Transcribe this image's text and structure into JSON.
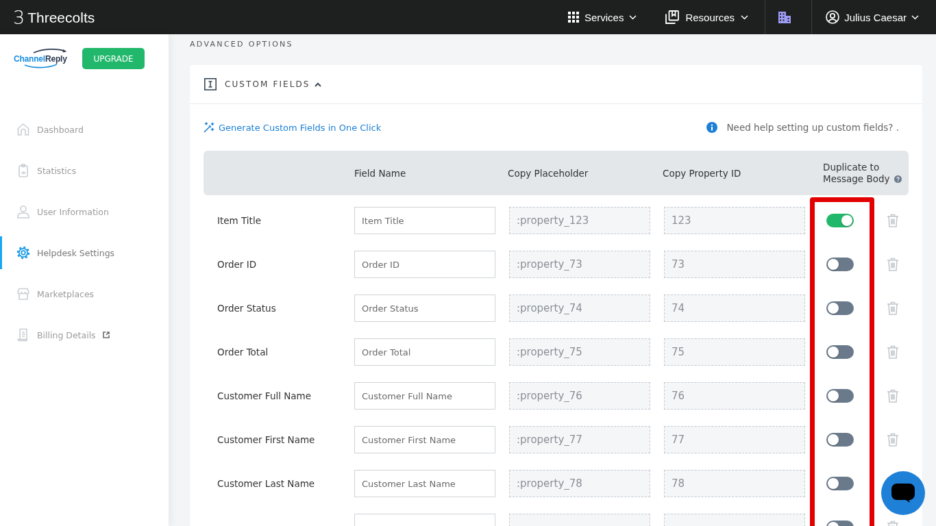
{
  "topbar": {
    "brand_mark": "3",
    "brand": "Threecolts",
    "menus": [
      {
        "label": "Services",
        "kind": "grid"
      },
      {
        "label": "Resources",
        "kind": "book"
      }
    ],
    "user": {
      "name": "Julius Caesar"
    }
  },
  "sidebar": {
    "logo": [
      "Channel",
      "Reply"
    ],
    "upgrade": "UPGRADE",
    "items": [
      {
        "label": "Dashboard",
        "kind": "home",
        "selected": false,
        "external": false
      },
      {
        "label": "Statistics",
        "kind": "clipboard",
        "selected": false,
        "external": false
      },
      {
        "label": "User Information",
        "kind": "user",
        "selected": false,
        "external": false
      },
      {
        "label": "Helpdesk Settings",
        "kind": "gear",
        "selected": true,
        "external": false
      },
      {
        "label": "Marketplaces",
        "kind": "store",
        "selected": false,
        "external": false
      },
      {
        "label": "Billing Details",
        "kind": "receipt",
        "selected": false,
        "external": true
      }
    ]
  },
  "section_title": "ADVANCED OPTIONS",
  "custom_fields": {
    "title": "CUSTOM FIELDS",
    "expanded": true,
    "generate_link": "Generate Custom Fields in One Click",
    "help_text": "Need help setting up custom fields? .",
    "columns": [
      "Field Name",
      "Copy Placeholder",
      "Copy Property ID",
      "Duplicate to Message Body"
    ],
    "rows": [
      {
        "label": "Item Title",
        "field_name": "Item Title",
        "property_token": ":property_123",
        "property_id": "123",
        "duplicate": true
      },
      {
        "label": "Order ID",
        "field_name": "Order ID",
        "property_token": ":property_73",
        "property_id": "73",
        "duplicate": false
      },
      {
        "label": "Order Status",
        "field_name": "Order Status",
        "property_token": ":property_74",
        "property_id": "74",
        "duplicate": false
      },
      {
        "label": "Order Total",
        "field_name": "Order Total",
        "property_token": ":property_75",
        "property_id": "75",
        "duplicate": false
      },
      {
        "label": "Customer Full Name",
        "field_name": "Customer Full Name",
        "property_token": ":property_76",
        "property_id": "76",
        "duplicate": false
      },
      {
        "label": "Customer First Name",
        "field_name": "Customer First Name",
        "property_token": ":property_77",
        "property_id": "77",
        "duplicate": false
      },
      {
        "label": "Customer Last Name",
        "field_name": "Customer Last Name",
        "property_token": ":property_78",
        "property_id": "78",
        "duplicate": false
      },
      {
        "duplicate": false
      }
    ]
  }
}
